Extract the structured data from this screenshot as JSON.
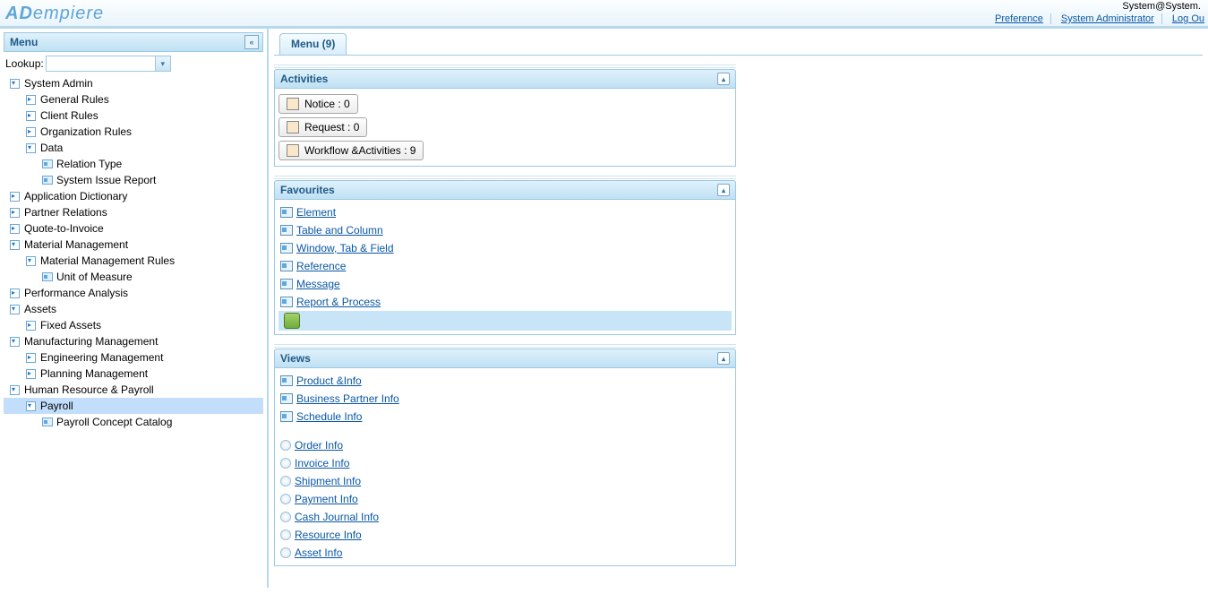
{
  "header": {
    "logo_prefix": "AD",
    "logo_rest": "empiere",
    "user": "System@System.",
    "links": {
      "preference": "Preference",
      "role": "System Administrator",
      "logout": "Log Ou"
    }
  },
  "sidebar": {
    "title": "Menu",
    "lookup_label": "Lookup:",
    "tree": [
      {
        "label": "System Admin",
        "type": "folder",
        "open": true,
        "indent": 0
      },
      {
        "label": "General Rules",
        "type": "folder",
        "open": false,
        "indent": 1
      },
      {
        "label": "Client Rules",
        "type": "folder",
        "open": false,
        "indent": 1
      },
      {
        "label": "Organization Rules",
        "type": "folder",
        "open": false,
        "indent": 1
      },
      {
        "label": "Data",
        "type": "folder",
        "open": true,
        "indent": 1
      },
      {
        "label": "Relation Type",
        "type": "leaf",
        "indent": 2
      },
      {
        "label": "System Issue Report",
        "type": "leaf",
        "indent": 2
      },
      {
        "label": "Application Dictionary",
        "type": "folder",
        "open": false,
        "indent": 0
      },
      {
        "label": "Partner Relations",
        "type": "folder",
        "open": false,
        "indent": 0
      },
      {
        "label": "Quote-to-Invoice",
        "type": "folder",
        "open": false,
        "indent": 0
      },
      {
        "label": "Material Management",
        "type": "folder",
        "open": true,
        "indent": 0
      },
      {
        "label": "Material Management Rules",
        "type": "folder",
        "open": true,
        "indent": 1
      },
      {
        "label": "Unit of Measure",
        "type": "leaf",
        "indent": 2
      },
      {
        "label": "Performance Analysis",
        "type": "folder",
        "open": false,
        "indent": 0
      },
      {
        "label": "Assets",
        "type": "folder",
        "open": true,
        "indent": 0
      },
      {
        "label": "Fixed Assets",
        "type": "folder",
        "open": false,
        "indent": 1
      },
      {
        "label": "Manufacturing Management",
        "type": "folder",
        "open": true,
        "indent": 0
      },
      {
        "label": "Engineering Management",
        "type": "folder",
        "open": false,
        "indent": 1
      },
      {
        "label": "Planning Management",
        "type": "folder",
        "open": false,
        "indent": 1
      },
      {
        "label": "Human Resource & Payroll",
        "type": "folder",
        "open": true,
        "indent": 0
      },
      {
        "label": "Payroll",
        "type": "folder",
        "open": true,
        "indent": 1,
        "selected": true
      },
      {
        "label": "Payroll Concept Catalog",
        "type": "leaf",
        "indent": 2
      }
    ]
  },
  "main": {
    "tab": "Menu (9)",
    "activities": {
      "title": "Activities",
      "notice": "Notice : 0",
      "request": "Request : 0",
      "workflow": "Workflow &Activities : 9"
    },
    "favourites": {
      "title": "Favourites",
      "items": [
        " Element",
        " Table and Column",
        " Window, Tab & Field",
        " Reference",
        " Message",
        " Report & Process"
      ]
    },
    "views": {
      "title": "Views",
      "group1": [
        " Product &Info",
        "Business Partner Info",
        " Schedule Info"
      ],
      "group2": [
        " Order Info",
        " Invoice Info",
        " Shipment Info",
        " Payment Info",
        " Cash Journal Info",
        " Resource Info",
        " Asset Info"
      ]
    }
  }
}
